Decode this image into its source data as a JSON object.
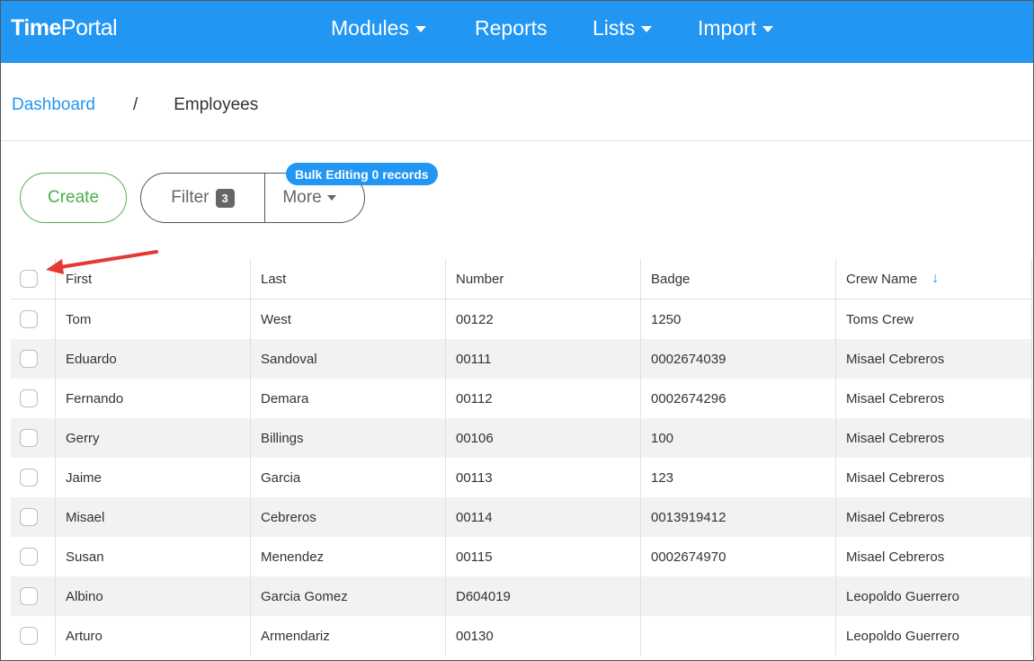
{
  "app": {
    "brand_part1": "Time",
    "brand_part2": "Portal"
  },
  "nav": {
    "items": [
      {
        "label": "Modules",
        "dropdown": true
      },
      {
        "label": "Reports",
        "dropdown": false
      },
      {
        "label": "Lists",
        "dropdown": true
      },
      {
        "label": "Import",
        "dropdown": true
      }
    ]
  },
  "breadcrumb": {
    "link": "Dashboard",
    "separator": "/",
    "current": "Employees"
  },
  "toolbar": {
    "create_label": "Create",
    "filter_label": "Filter",
    "filter_count": "3",
    "more_label": "More",
    "bulk_label": "Bulk Editing 0 records"
  },
  "table": {
    "columns": [
      "First",
      "Last",
      "Number",
      "Badge",
      "Crew Name"
    ],
    "sort_icon": "arrow-down-icon",
    "rows": [
      [
        "Tom",
        "West",
        "00122",
        "1250",
        "Toms Crew"
      ],
      [
        "Eduardo",
        "Sandoval",
        "00111",
        "0002674039",
        "Misael Cebreros"
      ],
      [
        "Fernando",
        "Demara",
        "00112",
        "0002674296",
        "Misael Cebreros"
      ],
      [
        "Gerry",
        "Billings",
        "00106",
        "100",
        "Misael Cebreros"
      ],
      [
        "Jaime",
        "Garcia",
        "00113",
        "123",
        "Misael Cebreros"
      ],
      [
        "Misael",
        "Cebreros",
        "00114",
        "0013919412",
        "Misael Cebreros"
      ],
      [
        "Susan",
        "Menendez",
        "00115",
        "0002674970",
        "Misael Cebreros"
      ],
      [
        "Albino",
        "Garcia Gomez",
        "D604019",
        "",
        "Leopoldo Guerrero"
      ],
      [
        "Arturo",
        "Armendariz",
        "00130",
        "",
        "Leopoldo Guerrero"
      ]
    ]
  },
  "colors": {
    "primary": "#2196f3",
    "create": "#4caf50",
    "arrow": "#e53935"
  }
}
